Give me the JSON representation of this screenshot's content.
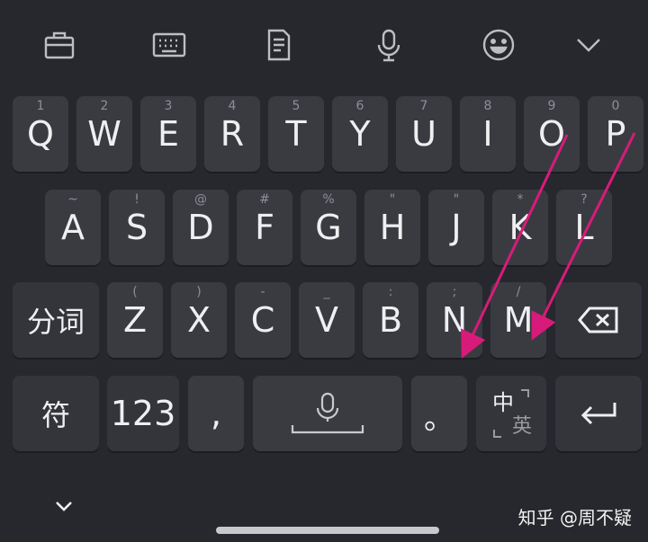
{
  "toolbar": {
    "items": [
      {
        "icon": "briefcase-icon"
      },
      {
        "icon": "keyboard-icon"
      },
      {
        "icon": "clipboard-icon"
      },
      {
        "icon": "microphone-icon"
      },
      {
        "icon": "emoji-icon"
      },
      {
        "icon": "chevron-down-icon"
      }
    ]
  },
  "rows": {
    "r1": [
      {
        "main": "Q",
        "sub": "1"
      },
      {
        "main": "W",
        "sub": "2"
      },
      {
        "main": "E",
        "sub": "3"
      },
      {
        "main": "R",
        "sub": "4"
      },
      {
        "main": "T",
        "sub": "5"
      },
      {
        "main": "Y",
        "sub": "6"
      },
      {
        "main": "U",
        "sub": "7"
      },
      {
        "main": "I",
        "sub": "8"
      },
      {
        "main": "O",
        "sub": "9"
      },
      {
        "main": "P",
        "sub": "0"
      }
    ],
    "r2": [
      {
        "main": "A",
        "sub": "~"
      },
      {
        "main": "S",
        "sub": "!"
      },
      {
        "main": "D",
        "sub": "@"
      },
      {
        "main": "F",
        "sub": "#"
      },
      {
        "main": "G",
        "sub": "%"
      },
      {
        "main": "H",
        "sub": "\""
      },
      {
        "main": "J",
        "sub": "\""
      },
      {
        "main": "K",
        "sub": "*"
      },
      {
        "main": "L",
        "sub": "?"
      }
    ],
    "r3": [
      {
        "main": "Z",
        "sub": "("
      },
      {
        "main": "X",
        "sub": ")"
      },
      {
        "main": "C",
        "sub": "-"
      },
      {
        "main": "V",
        "sub": "_"
      },
      {
        "main": "B",
        "sub": ":"
      },
      {
        "main": "N",
        "sub": ";"
      },
      {
        "main": "M",
        "sub": "/"
      }
    ]
  },
  "keys": {
    "segment": "分词",
    "symbols": "符",
    "numbers": "123",
    "comma": ",",
    "period": "。",
    "lang_zh": "中",
    "lang_en": "英"
  },
  "watermark": "知乎 @周不疑",
  "colors": {
    "background": "#27282d",
    "key": "#3a3b41",
    "arrow": "#d81b7a"
  }
}
